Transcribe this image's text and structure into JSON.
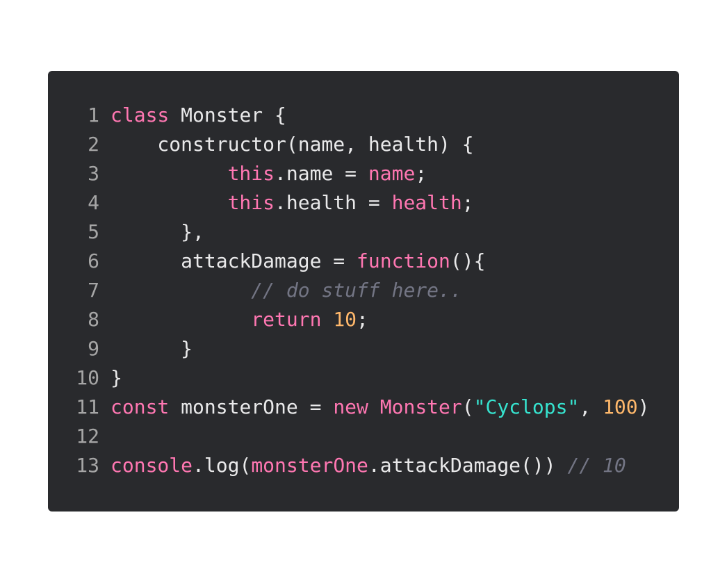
{
  "editor": {
    "colors": {
      "background": "#292a2d",
      "keyword": "#ff77b2",
      "string": "#36e3cf",
      "number": "#ffb86b",
      "comment": "#737584",
      "text": "#e9e9ea",
      "line_number": "#a6a6a6"
    },
    "lines": [
      {
        "n": "1",
        "tokens": [
          {
            "t": "class",
            "k": "kw"
          },
          {
            "t": " Monster {",
            "k": "pl"
          }
        ]
      },
      {
        "n": "2",
        "tokens": [
          {
            "t": "    constructor(name, health) {",
            "k": "pl"
          }
        ]
      },
      {
        "n": "3",
        "tokens": [
          {
            "t": "          ",
            "k": "pl"
          },
          {
            "t": "this",
            "k": "kw"
          },
          {
            "t": ".name = ",
            "k": "pl"
          },
          {
            "t": "name",
            "k": "kw"
          },
          {
            "t": ";",
            "k": "pl"
          }
        ]
      },
      {
        "n": "4",
        "tokens": [
          {
            "t": "          ",
            "k": "pl"
          },
          {
            "t": "this",
            "k": "kw"
          },
          {
            "t": ".health = ",
            "k": "pl"
          },
          {
            "t": "health",
            "k": "kw"
          },
          {
            "t": ";",
            "k": "pl"
          }
        ]
      },
      {
        "n": "5",
        "tokens": [
          {
            "t": "      },",
            "k": "pl"
          }
        ]
      },
      {
        "n": "6",
        "tokens": [
          {
            "t": "      attackDamage = ",
            "k": "pl"
          },
          {
            "t": "function",
            "k": "kw"
          },
          {
            "t": "(){",
            "k": "pl"
          }
        ]
      },
      {
        "n": "7",
        "tokens": [
          {
            "t": "            ",
            "k": "pl"
          },
          {
            "t": "// do stuff here..",
            "k": "cm"
          }
        ]
      },
      {
        "n": "8",
        "tokens": [
          {
            "t": "            ",
            "k": "pl"
          },
          {
            "t": "return",
            "k": "kw"
          },
          {
            "t": " ",
            "k": "pl"
          },
          {
            "t": "10",
            "k": "num"
          },
          {
            "t": ";",
            "k": "pl"
          }
        ]
      },
      {
        "n": "9",
        "tokens": [
          {
            "t": "      }",
            "k": "pl"
          }
        ]
      },
      {
        "n": "10",
        "tokens": [
          {
            "t": "}",
            "k": "pl"
          }
        ]
      },
      {
        "n": "11",
        "tokens": [
          {
            "t": "const",
            "k": "kw"
          },
          {
            "t": " monsterOne = ",
            "k": "pl"
          },
          {
            "t": "new",
            "k": "kw"
          },
          {
            "t": " ",
            "k": "pl"
          },
          {
            "t": "Monster",
            "k": "kw"
          },
          {
            "t": "(",
            "k": "pl"
          },
          {
            "t": "\"Cyclops\"",
            "k": "str"
          },
          {
            "t": ", ",
            "k": "pl"
          },
          {
            "t": "100",
            "k": "num"
          },
          {
            "t": ")",
            "k": "pl"
          }
        ]
      },
      {
        "n": "12",
        "tokens": []
      },
      {
        "n": "13",
        "tokens": [
          {
            "t": "console",
            "k": "kw"
          },
          {
            "t": ".log(",
            "k": "pl"
          },
          {
            "t": "monsterOne",
            "k": "kw"
          },
          {
            "t": ".attackDamage()) ",
            "k": "pl"
          },
          {
            "t": "// 10",
            "k": "cm"
          }
        ]
      }
    ]
  }
}
